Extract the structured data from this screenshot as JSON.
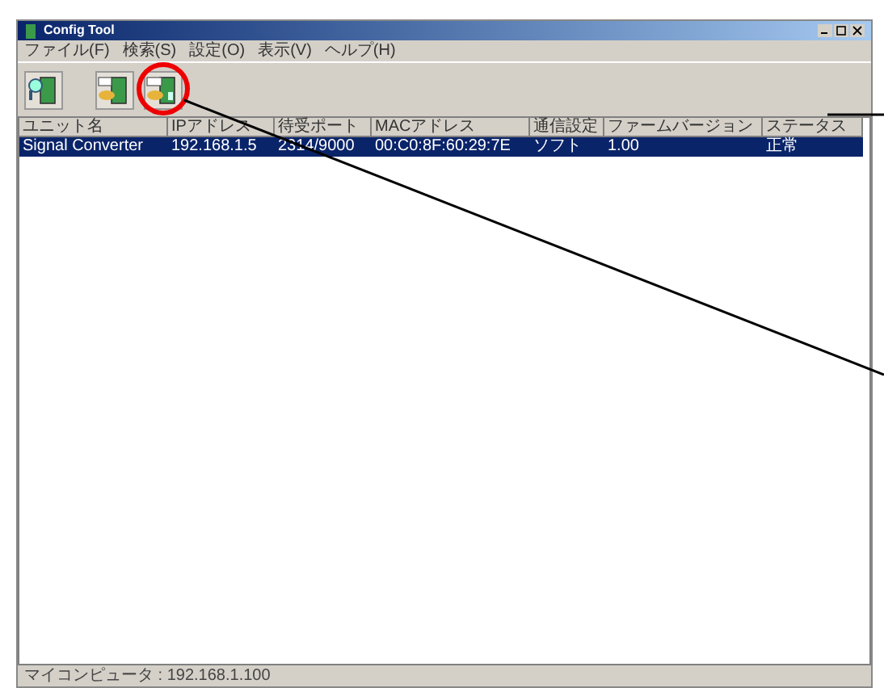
{
  "window": {
    "title": "Config Tool"
  },
  "menu": [
    "ファイル(F)",
    "検索(S)",
    "設定(O)",
    "表示(V)",
    "ヘルプ(H)"
  ],
  "toolbar": [
    {
      "kind": "search"
    },
    {
      "kind": "ip"
    },
    {
      "kind": "config"
    }
  ],
  "table": {
    "columns": [
      "ユニット名",
      "IPアドレス",
      "待受ポート",
      "MACアドレス",
      "通信設定",
      "ファームバージョン",
      "ステータス"
    ],
    "rows": [
      {
        "cells": [
          "Signal Converter",
          "192.168.1.5",
          "2314/9000",
          "00:C0:8F:60:29:7E",
          "ソフト",
          "1.00",
          "正常"
        ],
        "selected": true
      }
    ]
  },
  "status_bar": "マイコンピュータ : 192.168.1.100"
}
